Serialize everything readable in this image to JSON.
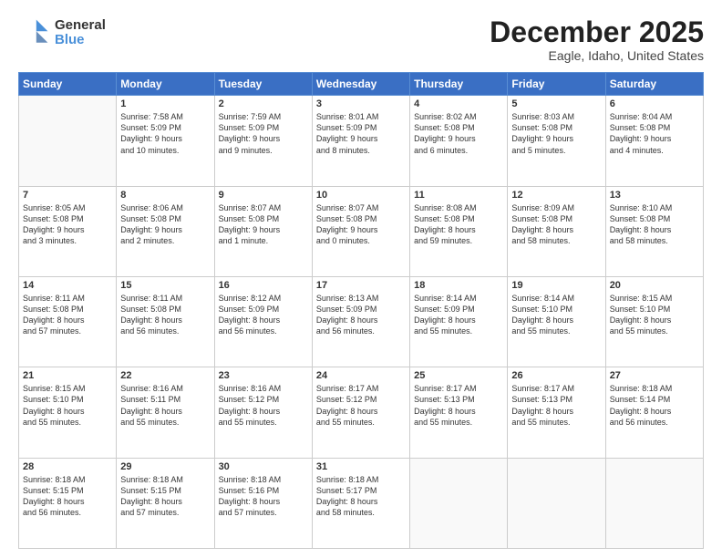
{
  "logo": {
    "general": "General",
    "blue": "Blue"
  },
  "header": {
    "month": "December 2025",
    "location": "Eagle, Idaho, United States"
  },
  "days_of_week": [
    "Sunday",
    "Monday",
    "Tuesday",
    "Wednesday",
    "Thursday",
    "Friday",
    "Saturday"
  ],
  "weeks": [
    [
      {
        "day": "",
        "info": ""
      },
      {
        "day": "1",
        "info": "Sunrise: 7:58 AM\nSunset: 5:09 PM\nDaylight: 9 hours\nand 10 minutes."
      },
      {
        "day": "2",
        "info": "Sunrise: 7:59 AM\nSunset: 5:09 PM\nDaylight: 9 hours\nand 9 minutes."
      },
      {
        "day": "3",
        "info": "Sunrise: 8:01 AM\nSunset: 5:09 PM\nDaylight: 9 hours\nand 8 minutes."
      },
      {
        "day": "4",
        "info": "Sunrise: 8:02 AM\nSunset: 5:08 PM\nDaylight: 9 hours\nand 6 minutes."
      },
      {
        "day": "5",
        "info": "Sunrise: 8:03 AM\nSunset: 5:08 PM\nDaylight: 9 hours\nand 5 minutes."
      },
      {
        "day": "6",
        "info": "Sunrise: 8:04 AM\nSunset: 5:08 PM\nDaylight: 9 hours\nand 4 minutes."
      }
    ],
    [
      {
        "day": "7",
        "info": "Sunrise: 8:05 AM\nSunset: 5:08 PM\nDaylight: 9 hours\nand 3 minutes."
      },
      {
        "day": "8",
        "info": "Sunrise: 8:06 AM\nSunset: 5:08 PM\nDaylight: 9 hours\nand 2 minutes."
      },
      {
        "day": "9",
        "info": "Sunrise: 8:07 AM\nSunset: 5:08 PM\nDaylight: 9 hours\nand 1 minute."
      },
      {
        "day": "10",
        "info": "Sunrise: 8:07 AM\nSunset: 5:08 PM\nDaylight: 9 hours\nand 0 minutes."
      },
      {
        "day": "11",
        "info": "Sunrise: 8:08 AM\nSunset: 5:08 PM\nDaylight: 8 hours\nand 59 minutes."
      },
      {
        "day": "12",
        "info": "Sunrise: 8:09 AM\nSunset: 5:08 PM\nDaylight: 8 hours\nand 58 minutes."
      },
      {
        "day": "13",
        "info": "Sunrise: 8:10 AM\nSunset: 5:08 PM\nDaylight: 8 hours\nand 58 minutes."
      }
    ],
    [
      {
        "day": "14",
        "info": "Sunrise: 8:11 AM\nSunset: 5:08 PM\nDaylight: 8 hours\nand 57 minutes."
      },
      {
        "day": "15",
        "info": "Sunrise: 8:11 AM\nSunset: 5:08 PM\nDaylight: 8 hours\nand 56 minutes."
      },
      {
        "day": "16",
        "info": "Sunrise: 8:12 AM\nSunset: 5:09 PM\nDaylight: 8 hours\nand 56 minutes."
      },
      {
        "day": "17",
        "info": "Sunrise: 8:13 AM\nSunset: 5:09 PM\nDaylight: 8 hours\nand 56 minutes."
      },
      {
        "day": "18",
        "info": "Sunrise: 8:14 AM\nSunset: 5:09 PM\nDaylight: 8 hours\nand 55 minutes."
      },
      {
        "day": "19",
        "info": "Sunrise: 8:14 AM\nSunset: 5:10 PM\nDaylight: 8 hours\nand 55 minutes."
      },
      {
        "day": "20",
        "info": "Sunrise: 8:15 AM\nSunset: 5:10 PM\nDaylight: 8 hours\nand 55 minutes."
      }
    ],
    [
      {
        "day": "21",
        "info": "Sunrise: 8:15 AM\nSunset: 5:10 PM\nDaylight: 8 hours\nand 55 minutes."
      },
      {
        "day": "22",
        "info": "Sunrise: 8:16 AM\nSunset: 5:11 PM\nDaylight: 8 hours\nand 55 minutes."
      },
      {
        "day": "23",
        "info": "Sunrise: 8:16 AM\nSunset: 5:12 PM\nDaylight: 8 hours\nand 55 minutes."
      },
      {
        "day": "24",
        "info": "Sunrise: 8:17 AM\nSunset: 5:12 PM\nDaylight: 8 hours\nand 55 minutes."
      },
      {
        "day": "25",
        "info": "Sunrise: 8:17 AM\nSunset: 5:13 PM\nDaylight: 8 hours\nand 55 minutes."
      },
      {
        "day": "26",
        "info": "Sunrise: 8:17 AM\nSunset: 5:13 PM\nDaylight: 8 hours\nand 55 minutes."
      },
      {
        "day": "27",
        "info": "Sunrise: 8:18 AM\nSunset: 5:14 PM\nDaylight: 8 hours\nand 56 minutes."
      }
    ],
    [
      {
        "day": "28",
        "info": "Sunrise: 8:18 AM\nSunset: 5:15 PM\nDaylight: 8 hours\nand 56 minutes."
      },
      {
        "day": "29",
        "info": "Sunrise: 8:18 AM\nSunset: 5:15 PM\nDaylight: 8 hours\nand 57 minutes."
      },
      {
        "day": "30",
        "info": "Sunrise: 8:18 AM\nSunset: 5:16 PM\nDaylight: 8 hours\nand 57 minutes."
      },
      {
        "day": "31",
        "info": "Sunrise: 8:18 AM\nSunset: 5:17 PM\nDaylight: 8 hours\nand 58 minutes."
      },
      {
        "day": "",
        "info": ""
      },
      {
        "day": "",
        "info": ""
      },
      {
        "day": "",
        "info": ""
      }
    ]
  ]
}
